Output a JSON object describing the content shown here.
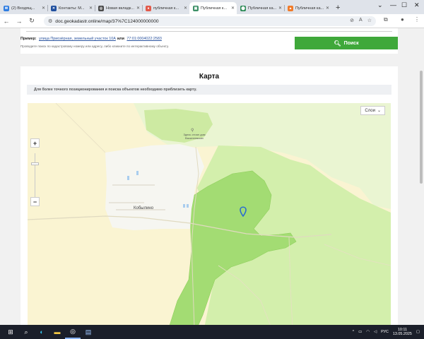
{
  "browser": {
    "tabs": [
      {
        "title": "(2) Входящ...",
        "favicon_color": "#2f7de1",
        "favicon_glyph": "✉"
      },
      {
        "title": "Контакты: М...",
        "favicon_color": "#1f4f9e",
        "favicon_glyph": "✕"
      },
      {
        "title": "Новая вкладк...",
        "favicon_color": "#4a4a4a",
        "favicon_glyph": "◎"
      },
      {
        "title": "публичная к...",
        "favicon_color": "#e25a4b",
        "favicon_glyph": "●"
      },
      {
        "title": "Публичная к...",
        "favicon_color": "#3c8f66",
        "favicon_glyph": "▣",
        "active": true
      },
      {
        "title": "Публичная ка...",
        "favicon_color": "#2e8b57",
        "favicon_glyph": "⬤"
      },
      {
        "title": "Публичная ка...",
        "favicon_color": "#f07b2a",
        "favicon_glyph": "▲"
      }
    ],
    "new_tab": "+",
    "window_controls": [
      "⌄",
      "—",
      "☐",
      "✕"
    ],
    "url": "doc.geokadastr.online/map/37%7C124000000000"
  },
  "search": {
    "example_prefix": "Пример:",
    "example_address": "улица Приозёрная, земельный участок 10А",
    "example_or": "или",
    "example_number": "77:01:0004022:2583",
    "hint": "Проводите поиск по кадастровому номеру или адресу, либо кликните по интерактивному объекту.",
    "button_label": "Поиск"
  },
  "map_section": {
    "title": "Карта",
    "notice": "Для более точного позиционирования и поиска объектов необходимо приблизить карту.",
    "layers_label": "Слои",
    "zoom_in": "+",
    "zoom_out": "−",
    "labels": {
      "village": "Кобылино",
      "monument": "Здесь стоял дом Василеевских"
    },
    "colors": {
      "field": "#faf4d2",
      "forest_light": "#d6f0b2",
      "forest": "#b9e38c",
      "parcel": "#9ad86b",
      "settlement": "#f4f4f0",
      "marker": "#2a6cd0"
    }
  },
  "taskbar": {
    "language": "РУС",
    "time": "10:11",
    "date": "13.05.2025",
    "icons": [
      "windows-logo",
      "search",
      "edge",
      "file-explorer",
      "chrome",
      "notepad"
    ]
  }
}
